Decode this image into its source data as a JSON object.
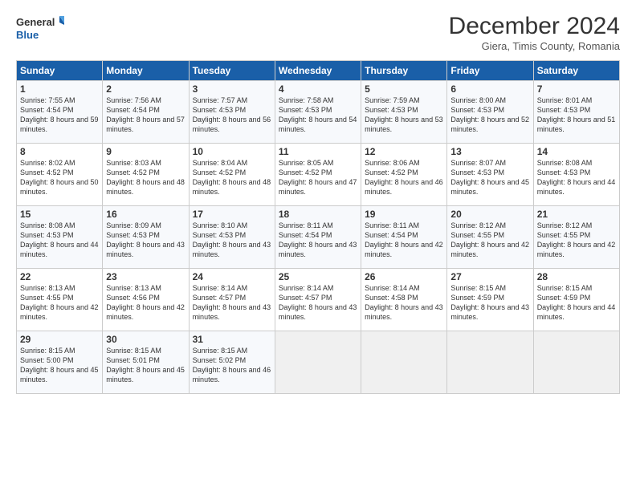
{
  "logo": {
    "line1": "General",
    "line2": "Blue"
  },
  "title": "December 2024",
  "location": "Giera, Timis County, Romania",
  "days_of_week": [
    "Sunday",
    "Monday",
    "Tuesday",
    "Wednesday",
    "Thursday",
    "Friday",
    "Saturday"
  ],
  "weeks": [
    [
      {
        "day": "1",
        "sunrise": "7:55 AM",
        "sunset": "4:54 PM",
        "daylight": "8 hours and 59 minutes."
      },
      {
        "day": "2",
        "sunrise": "7:56 AM",
        "sunset": "4:54 PM",
        "daylight": "8 hours and 57 minutes."
      },
      {
        "day": "3",
        "sunrise": "7:57 AM",
        "sunset": "4:53 PM",
        "daylight": "8 hours and 56 minutes."
      },
      {
        "day": "4",
        "sunrise": "7:58 AM",
        "sunset": "4:53 PM",
        "daylight": "8 hours and 54 minutes."
      },
      {
        "day": "5",
        "sunrise": "7:59 AM",
        "sunset": "4:53 PM",
        "daylight": "8 hours and 53 minutes."
      },
      {
        "day": "6",
        "sunrise": "8:00 AM",
        "sunset": "4:53 PM",
        "daylight": "8 hours and 52 minutes."
      },
      {
        "day": "7",
        "sunrise": "8:01 AM",
        "sunset": "4:53 PM",
        "daylight": "8 hours and 51 minutes."
      }
    ],
    [
      {
        "day": "8",
        "sunrise": "8:02 AM",
        "sunset": "4:52 PM",
        "daylight": "8 hours and 50 minutes."
      },
      {
        "day": "9",
        "sunrise": "8:03 AM",
        "sunset": "4:52 PM",
        "daylight": "8 hours and 48 minutes."
      },
      {
        "day": "10",
        "sunrise": "8:04 AM",
        "sunset": "4:52 PM",
        "daylight": "8 hours and 48 minutes."
      },
      {
        "day": "11",
        "sunrise": "8:05 AM",
        "sunset": "4:52 PM",
        "daylight": "8 hours and 47 minutes."
      },
      {
        "day": "12",
        "sunrise": "8:06 AM",
        "sunset": "4:52 PM",
        "daylight": "8 hours and 46 minutes."
      },
      {
        "day": "13",
        "sunrise": "8:07 AM",
        "sunset": "4:53 PM",
        "daylight": "8 hours and 45 minutes."
      },
      {
        "day": "14",
        "sunrise": "8:08 AM",
        "sunset": "4:53 PM",
        "daylight": "8 hours and 44 minutes."
      }
    ],
    [
      {
        "day": "15",
        "sunrise": "8:08 AM",
        "sunset": "4:53 PM",
        "daylight": "8 hours and 44 minutes."
      },
      {
        "day": "16",
        "sunrise": "8:09 AM",
        "sunset": "4:53 PM",
        "daylight": "8 hours and 43 minutes."
      },
      {
        "day": "17",
        "sunrise": "8:10 AM",
        "sunset": "4:53 PM",
        "daylight": "8 hours and 43 minutes."
      },
      {
        "day": "18",
        "sunrise": "8:11 AM",
        "sunset": "4:54 PM",
        "daylight": "8 hours and 43 minutes."
      },
      {
        "day": "19",
        "sunrise": "8:11 AM",
        "sunset": "4:54 PM",
        "daylight": "8 hours and 42 minutes."
      },
      {
        "day": "20",
        "sunrise": "8:12 AM",
        "sunset": "4:55 PM",
        "daylight": "8 hours and 42 minutes."
      },
      {
        "day": "21",
        "sunrise": "8:12 AM",
        "sunset": "4:55 PM",
        "daylight": "8 hours and 42 minutes."
      }
    ],
    [
      {
        "day": "22",
        "sunrise": "8:13 AM",
        "sunset": "4:55 PM",
        "daylight": "8 hours and 42 minutes."
      },
      {
        "day": "23",
        "sunrise": "8:13 AM",
        "sunset": "4:56 PM",
        "daylight": "8 hours and 42 minutes."
      },
      {
        "day": "24",
        "sunrise": "8:14 AM",
        "sunset": "4:57 PM",
        "daylight": "8 hours and 43 minutes."
      },
      {
        "day": "25",
        "sunrise": "8:14 AM",
        "sunset": "4:57 PM",
        "daylight": "8 hours and 43 minutes."
      },
      {
        "day": "26",
        "sunrise": "8:14 AM",
        "sunset": "4:58 PM",
        "daylight": "8 hours and 43 minutes."
      },
      {
        "day": "27",
        "sunrise": "8:15 AM",
        "sunset": "4:59 PM",
        "daylight": "8 hours and 43 minutes."
      },
      {
        "day": "28",
        "sunrise": "8:15 AM",
        "sunset": "4:59 PM",
        "daylight": "8 hours and 44 minutes."
      }
    ],
    [
      {
        "day": "29",
        "sunrise": "8:15 AM",
        "sunset": "5:00 PM",
        "daylight": "8 hours and 45 minutes."
      },
      {
        "day": "30",
        "sunrise": "8:15 AM",
        "sunset": "5:01 PM",
        "daylight": "8 hours and 45 minutes."
      },
      {
        "day": "31",
        "sunrise": "8:15 AM",
        "sunset": "5:02 PM",
        "daylight": "8 hours and 46 minutes."
      },
      null,
      null,
      null,
      null
    ]
  ]
}
